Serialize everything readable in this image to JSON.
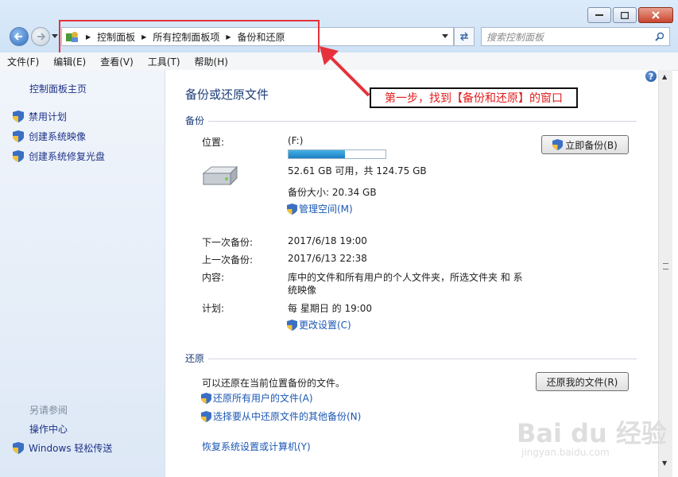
{
  "address": {
    "crumbs": [
      "控制面板",
      "所有控制面板项",
      "备份和还原"
    ]
  },
  "search": {
    "placeholder": "搜索控制面板"
  },
  "menu": [
    "文件(F)",
    "编辑(E)",
    "查看(V)",
    "工具(T)",
    "帮助(H)"
  ],
  "sidebar": {
    "home": "控制面板主页",
    "items": [
      "禁用计划",
      "创建系统映像",
      "创建系统修复光盘"
    ],
    "see_also_title": "另请参阅",
    "see_also": [
      "操作中心",
      "Windows 轻松传送"
    ]
  },
  "main": {
    "title": "备份或还原文件",
    "backup_section": "备份",
    "location_label": "位置:",
    "location_value": "(F:)",
    "disk_usage_fraction": 0.58,
    "disk_space": "52.61 GB 可用，共 124.75 GB",
    "backup_size": "备份大小: 20.34 GB",
    "manage_space": "管理空间(M)",
    "backup_now": "立即备份(B)",
    "next_label": "下一次备份:",
    "next_value": "2017/6/18 19:00",
    "last_label": "上一次备份:",
    "last_value": "2017/6/13 22:38",
    "content_label": "内容:",
    "content_value_line1": "库中的文件和所有用户的个人文件夹，所选文件夹 和 系",
    "content_value_line2": "统映像",
    "schedule_label": "计划:",
    "schedule_value": "每 星期日 的 19:00",
    "change_settings": "更改设置(C)",
    "restore_section": "还原",
    "restore_text": "可以还原在当前位置备份的文件。",
    "restore_my_files": "还原我的文件(R)",
    "restore_all_users": "还原所有用户的文件(A)",
    "restore_other": "选择要从中还原文件的其他备份(N)",
    "recover_system": "恢复系统设置或计算机(Y)"
  },
  "annotation": "第一步，找到【备份和还原】的窗口",
  "watermark": {
    "main": "Bai du 经验",
    "sub": "jingyan.baidu.com"
  },
  "colors": {
    "link": "#1b57b4",
    "heading": "#1c3c78",
    "annotation_red": "#e21b1b",
    "highlight_box": "#e5323c"
  }
}
